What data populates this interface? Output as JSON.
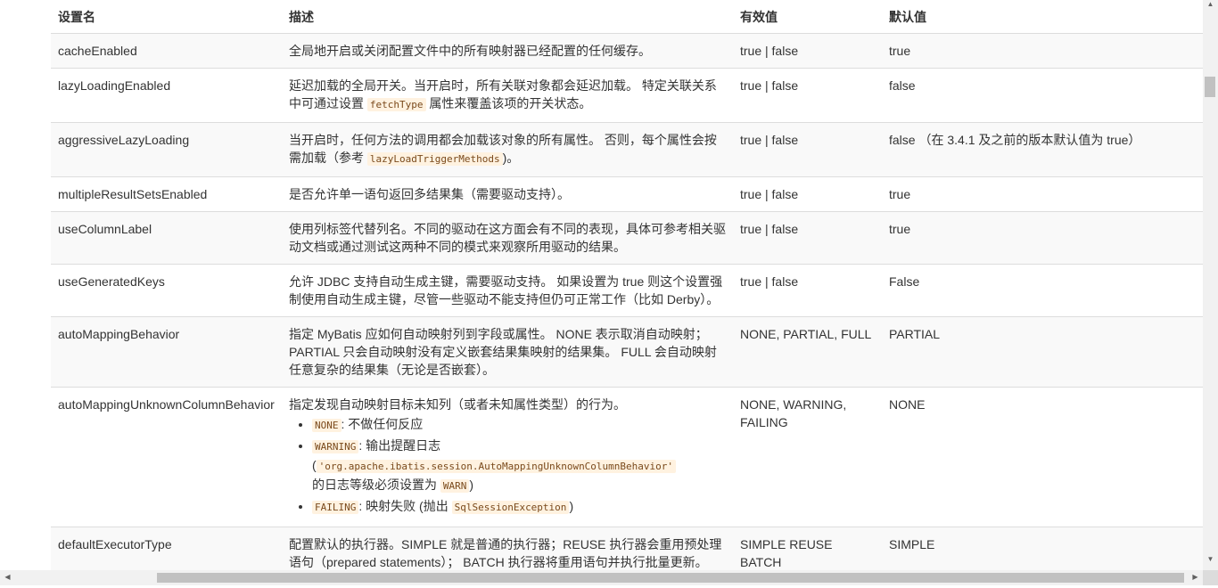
{
  "table": {
    "headers": [
      "设置名",
      "描述",
      "有效值",
      "默认值"
    ],
    "rows": [
      {
        "name": "cacheEnabled",
        "desc": "全局地开启或关闭配置文件中的所有映射器已经配置的任何缓存。",
        "valid": "true | false",
        "default": "true"
      },
      {
        "name": "lazyLoadingEnabled",
        "desc_pre": "延迟加载的全局开关。当开启时，所有关联对象都会延迟加载。 特定关联关系中可通过设置 ",
        "desc_code": "fetchType",
        "desc_post": " 属性来覆盖该项的开关状态。",
        "valid": "true | false",
        "default": "false"
      },
      {
        "name": "aggressiveLazyLoading",
        "desc_pre": "当开启时，任何方法的调用都会加载该对象的所有属性。 否则，每个属性会按需加载（参考 ",
        "desc_code": "lazyLoadTriggerMethods",
        "desc_post": ")。",
        "valid": "true | false",
        "default": "false （在 3.4.1 及之前的版本默认值为 true）"
      },
      {
        "name": "multipleResultSetsEnabled",
        "desc": "是否允许单一语句返回多结果集（需要驱动支持）。",
        "valid": "true | false",
        "default": "true"
      },
      {
        "name": "useColumnLabel",
        "desc": "使用列标签代替列名。不同的驱动在这方面会有不同的表现，具体可参考相关驱动文档或通过测试这两种不同的模式来观察所用驱动的结果。",
        "valid": "true | false",
        "default": "true"
      },
      {
        "name": "useGeneratedKeys",
        "desc": "允许 JDBC 支持自动生成主键，需要驱动支持。 如果设置为 true 则这个设置强制使用自动生成主键，尽管一些驱动不能支持但仍可正常工作（比如 Derby）。",
        "valid": "true | false",
        "default": "False"
      },
      {
        "name": "autoMappingBehavior",
        "desc": "指定 MyBatis 应如何自动映射列到字段或属性。 NONE 表示取消自动映射；PARTIAL 只会自动映射没有定义嵌套结果集映射的结果集。 FULL 会自动映射任意复杂的结果集（无论是否嵌套）。",
        "valid": "NONE, PARTIAL, FULL",
        "default": "PARTIAL"
      },
      {
        "name": "autoMappingUnknownColumnBehavior",
        "desc_intro": "指定发现自动映射目标未知列（或者未知属性类型）的行为。",
        "opt1_code": "NONE",
        "opt1_text": ": 不做任何反应",
        "opt2_code": "WARNING",
        "opt2_text": ": 输出提醒日志",
        "opt2_paren_open": "(",
        "opt2_class": "'org.apache.ibatis.session.AutoMappingUnknownColumnBehavior'",
        "opt2_mid": "的日志等级必须设置为 ",
        "opt2_level": "WARN",
        "opt2_paren_close": ")",
        "opt3_code": "FAILING",
        "opt3_text": ": 映射失败 (抛出 ",
        "opt3_exc": "SqlSessionException",
        "opt3_close": ")",
        "valid": "NONE, WARNING, FAILING",
        "default": "NONE"
      },
      {
        "name": "defaultExecutorType",
        "desc": "配置默认的执行器。SIMPLE 就是普通的执行器；REUSE 执行器会重用预处理语句（prepared statements）； BATCH 执行器将重用语句并执行批量更新。",
        "valid": "SIMPLE REUSE BATCH",
        "default": "SIMPLE"
      }
    ]
  },
  "scrollbars": {
    "up_arrow": "▲",
    "down_arrow": "▼",
    "left_arrow": "◀",
    "right_arrow": "▶",
    "vertical_scroll_position": 0.13,
    "horizontal_scroll_position": 0.13
  }
}
